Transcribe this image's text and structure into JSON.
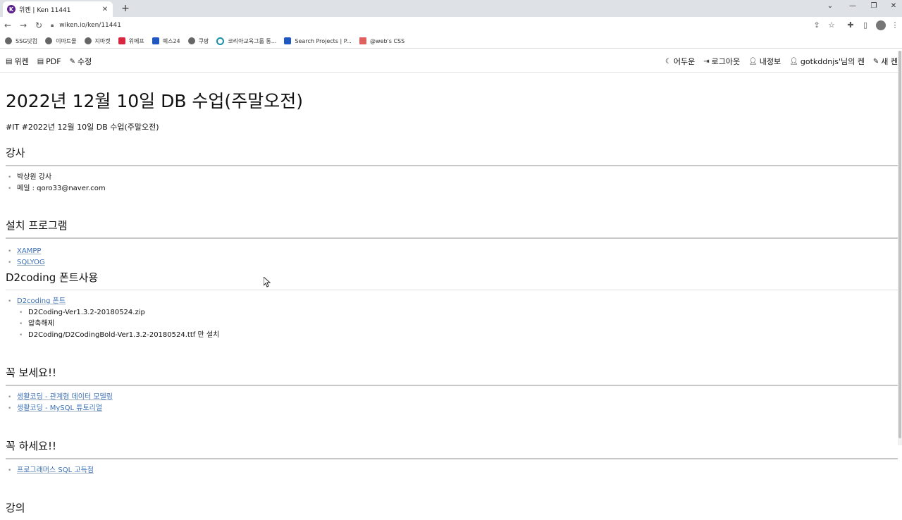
{
  "browser": {
    "tab_title": "위켄 | Ken 11441",
    "favicon_letter": "K",
    "url": "wiken.io/ken/11441",
    "bookmarks": [
      {
        "label": "SSG닷컴",
        "icon": "globe-icon"
      },
      {
        "label": "이마트몰",
        "icon": "globe-icon"
      },
      {
        "label": "지마켓",
        "icon": "globe-icon"
      },
      {
        "label": "위메프",
        "icon": "wemakeprice-icon"
      },
      {
        "label": "예스24",
        "icon": "yes24-icon"
      },
      {
        "label": "쿠팡",
        "icon": "globe-icon"
      },
      {
        "label": "코리아교육그룹 통...",
        "icon": "korea-edu-icon"
      },
      {
        "label": "Search Projects | P...",
        "icon": "behance-icon"
      },
      {
        "label": "@web's CSS",
        "icon": "image-icon"
      }
    ]
  },
  "nav": {
    "left": [
      {
        "label": "위켄",
        "icon": "file-icon"
      },
      {
        "label": "PDF",
        "icon": "pdf-icon"
      },
      {
        "label": "수정",
        "icon": "edit-icon"
      }
    ],
    "right": [
      {
        "label": "어두운",
        "icon": "moon-icon"
      },
      {
        "label": "로그아웃",
        "icon": "logout-icon"
      },
      {
        "label": "내정보",
        "icon": "user-gear-icon"
      },
      {
        "label": "gotkddnjs'님의 켄",
        "icon": "user-edit-icon"
      },
      {
        "label": "새 켄",
        "icon": "pencil-icon"
      }
    ]
  },
  "page": {
    "title": "2022년 12월 10일 DB 수업(주말오전)",
    "tags": "#IT #2022년 12월 10일 DB 수업(주말오전)",
    "sections": {
      "instructor": {
        "heading": "강사",
        "items": [
          "박상원 강사",
          "메일 : qoro33@naver.com"
        ]
      },
      "install": {
        "heading": "설치 프로그램",
        "links": [
          "XAMPP",
          "SQLYOG"
        ]
      },
      "font": {
        "heading": "D2coding 폰트사용",
        "link": "D2coding 폰트",
        "subitems": [
          "D2Coding-Ver1.3.2-20180524.zip",
          "압축해제",
          "D2Coding/D2CodingBold-Ver1.3.2-20180524.ttf 만 설치"
        ]
      },
      "watch": {
        "heading": "꼭 보세요!!",
        "links": [
          "생활코딩 - 관계형 데이터 모델링",
          "생활코딩 - MySQL 튜토리얼"
        ]
      },
      "do": {
        "heading": "꼭 하세요!!",
        "links": [
          "프로그래머스 SQL 고득점"
        ]
      },
      "lecture": {
        "heading": "강의"
      }
    }
  }
}
